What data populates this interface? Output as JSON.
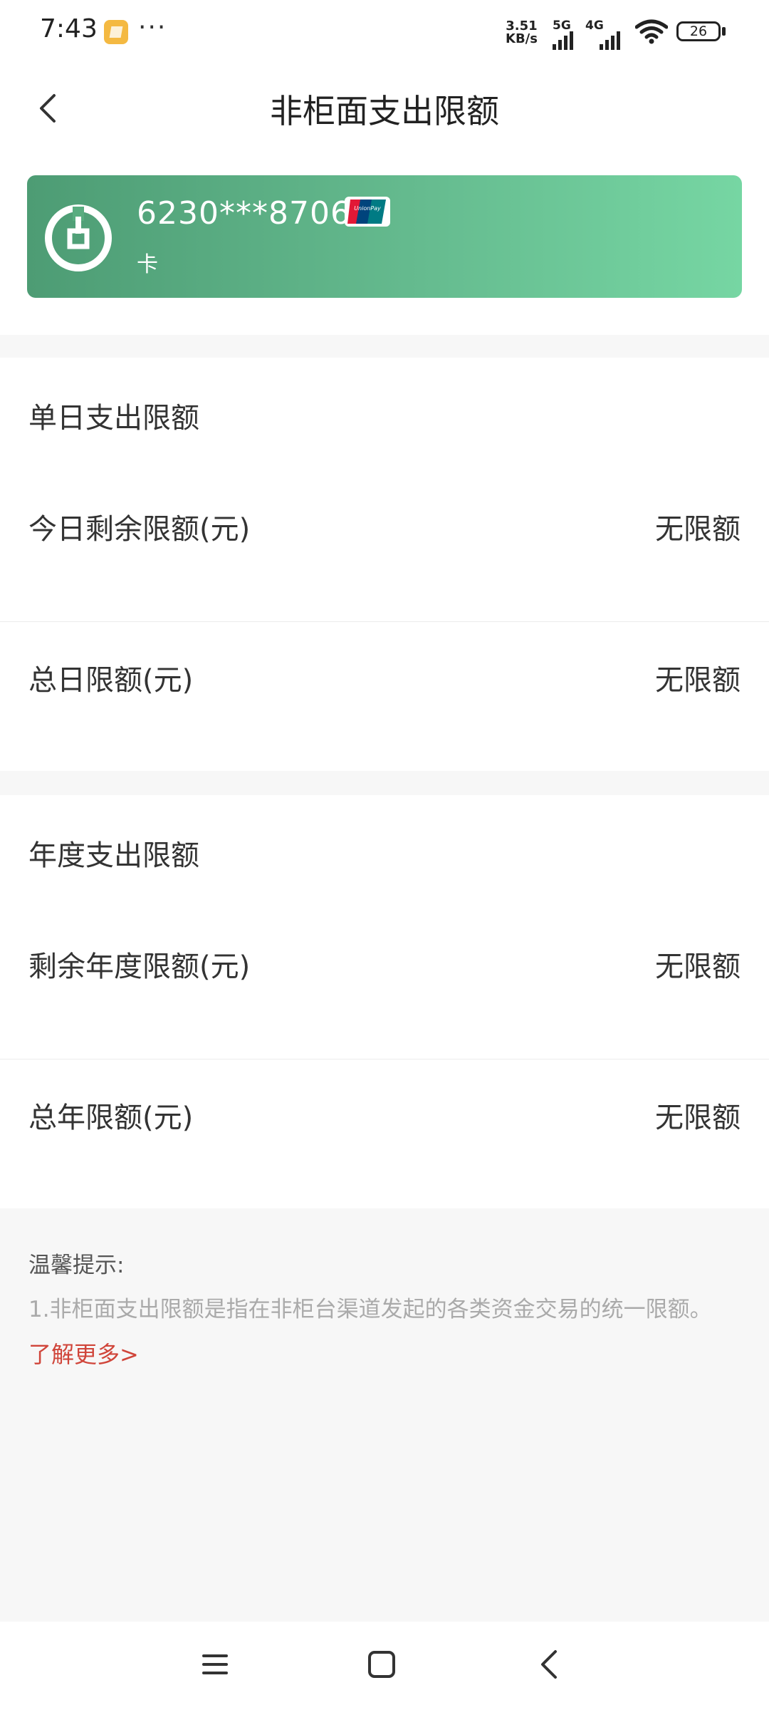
{
  "status_bar": {
    "time": "7:43",
    "more": "···",
    "net_speed_value": "3.51",
    "net_speed_unit": "KB/s",
    "sig1": "5G",
    "sig2": "4G",
    "battery": "26"
  },
  "header": {
    "title": "非柜面支出限额"
  },
  "card": {
    "number": "6230***8706",
    "type": "卡",
    "brand": "UnionPay",
    "gradient": [
      "#4d9c74",
      "#76d6a3"
    ]
  },
  "daily": {
    "title": "单日支出限额",
    "rows": [
      {
        "label": "今日剩余限额(元)",
        "value": "无限额"
      },
      {
        "label": "总日限额(元)",
        "value": "无限额"
      }
    ]
  },
  "yearly": {
    "title": "年度支出限额",
    "rows": [
      {
        "label": "剩余年度限额(元)",
        "value": "无限额"
      },
      {
        "label": "总年限额(元)",
        "value": "无限额"
      }
    ]
  },
  "tips": {
    "title": "温馨提示:",
    "text": "1.非柜面支出限额是指在非柜台渠道发起的各类资金交易的统一限额。",
    "link": "了解更多>",
    "link_color": "#d0453a"
  },
  "nav": {
    "icons": [
      "menu-icon",
      "home-icon",
      "back-icon"
    ]
  }
}
